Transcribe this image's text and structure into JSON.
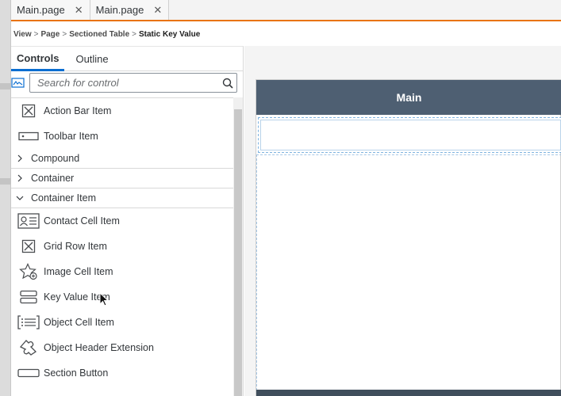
{
  "editor_tabs": [
    {
      "label": "Main.page",
      "close": "✕"
    },
    {
      "label": "Main.page",
      "close": "✕"
    }
  ],
  "breadcrumb": {
    "items": [
      "View",
      "Page",
      "Sectioned Table"
    ],
    "current": "Static Key Value",
    "separator": ">"
  },
  "panel": {
    "tabs": [
      "Controls",
      "Outline"
    ],
    "search_placeholder": "Search for control",
    "items": [
      {
        "type": "item",
        "label": "Action Bar Item",
        "icon": "action-bar-item-icon"
      },
      {
        "type": "item",
        "label": "Toolbar Item",
        "icon": "toolbar-item-icon"
      },
      {
        "type": "group",
        "label": "Compound",
        "expanded": false
      },
      {
        "type": "group",
        "label": "Container",
        "expanded": false
      },
      {
        "type": "group",
        "label": "Container Item",
        "expanded": true
      },
      {
        "type": "item",
        "label": "Contact Cell Item",
        "icon": "contact-cell-icon"
      },
      {
        "type": "item",
        "label": "Grid Row Item",
        "icon": "grid-row-icon"
      },
      {
        "type": "item",
        "label": "Image Cell Item",
        "icon": "image-cell-icon"
      },
      {
        "type": "item",
        "label": "Key Value Item",
        "icon": "key-value-icon"
      },
      {
        "type": "item",
        "label": "Object Cell Item",
        "icon": "object-cell-icon"
      },
      {
        "type": "item",
        "label": "Object Header Extension",
        "icon": "object-header-extension-icon"
      },
      {
        "type": "item",
        "label": "Section Button",
        "icon": "section-button-icon"
      }
    ]
  },
  "preview": {
    "header_title": "Main"
  },
  "colors": {
    "accent_orange": "#e9730c",
    "tab_active_blue": "#0a6ed1",
    "preview_header": "#4e5f72"
  }
}
